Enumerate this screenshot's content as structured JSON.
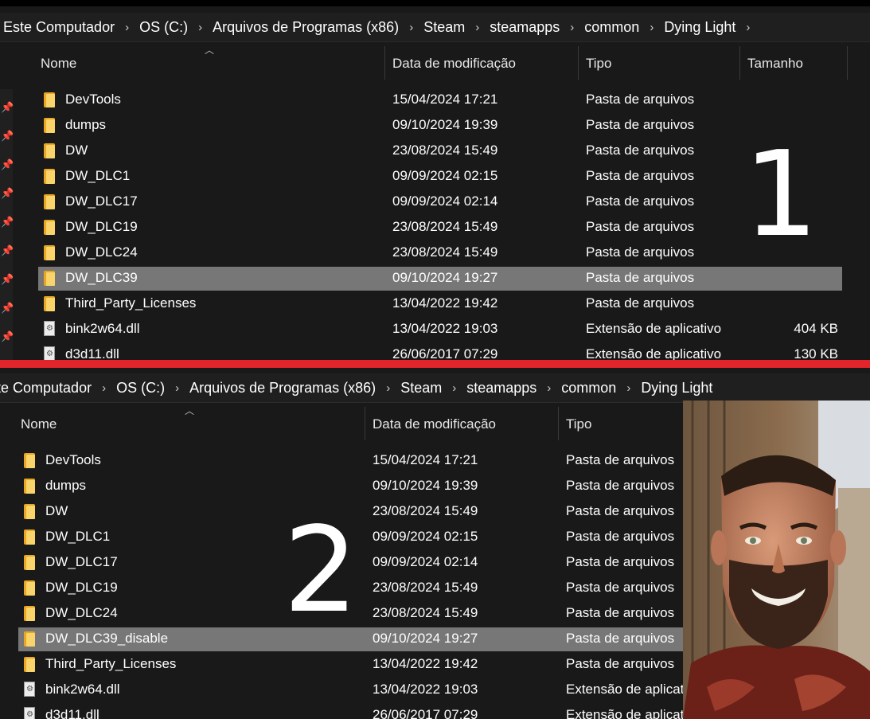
{
  "breadcrumb": [
    "Este Computador",
    "OS (C:)",
    "Arquivos de Programas (x86)",
    "Steam",
    "steamapps",
    "common",
    "Dying Light"
  ],
  "columns": {
    "name": "Nome",
    "date": "Data de modificação",
    "type": "Tipo",
    "size": "Tamanho"
  },
  "panel1": {
    "label": "1",
    "rows": [
      {
        "name": "DevTools",
        "date": "15/04/2024 17:21",
        "type": "Pasta de arquivos",
        "size": ""
      },
      {
        "name": "dumps",
        "date": "09/10/2024 19:39",
        "type": "Pasta de arquivos",
        "size": ""
      },
      {
        "name": "DW",
        "date": "23/08/2024 15:49",
        "type": "Pasta de arquivos",
        "size": ""
      },
      {
        "name": "DW_DLC1",
        "date": "09/09/2024 02:15",
        "type": "Pasta de arquivos",
        "size": ""
      },
      {
        "name": "DW_DLC17",
        "date": "09/09/2024 02:14",
        "type": "Pasta de arquivos",
        "size": ""
      },
      {
        "name": "DW_DLC19",
        "date": "23/08/2024 15:49",
        "type": "Pasta de arquivos",
        "size": ""
      },
      {
        "name": "DW_DLC24",
        "date": "23/08/2024 15:49",
        "type": "Pasta de arquivos",
        "size": ""
      },
      {
        "name": "DW_DLC39",
        "date": "09/10/2024 19:27",
        "type": "Pasta de arquivos",
        "size": ""
      },
      {
        "name": "Third_Party_Licenses",
        "date": "13/04/2022 19:42",
        "type": "Pasta de arquivos",
        "size": ""
      },
      {
        "name": "bink2w64.dll",
        "date": "13/04/2022 19:03",
        "type": "Extensão de aplicativo",
        "size": "404 KB"
      },
      {
        "name": "d3d11.dll",
        "date": "26/06/2017 07:29",
        "type": "Extensão de aplicativo",
        "size": "130 KB"
      }
    ]
  },
  "panel2": {
    "label": "2",
    "rows": [
      {
        "name": "DevTools",
        "date": "15/04/2024 17:21",
        "type": "Pasta de arquivos"
      },
      {
        "name": "dumps",
        "date": "09/10/2024 19:39",
        "type": "Pasta de arquivos"
      },
      {
        "name": "DW",
        "date": "23/08/2024 15:49",
        "type": "Pasta de arquivos"
      },
      {
        "name": "DW_DLC1",
        "date": "09/09/2024 02:15",
        "type": "Pasta de arquivos"
      },
      {
        "name": "DW_DLC17",
        "date": "09/09/2024 02:14",
        "type": "Pasta de arquivos"
      },
      {
        "name": "DW_DLC19",
        "date": "23/08/2024 15:49",
        "type": "Pasta de arquivos"
      },
      {
        "name": "DW_DLC24",
        "date": "23/08/2024 15:49",
        "type": "Pasta de arquivos"
      },
      {
        "name": "DW_DLC39_disable",
        "date": "09/10/2024 19:27",
        "type": "Pasta de arquivos"
      },
      {
        "name": "Third_Party_Licenses",
        "date": "13/04/2022 19:42",
        "type": "Pasta de arquivos"
      },
      {
        "name": "bink2w64.dll",
        "date": "13/04/2022 19:03",
        "type": "Extensão de aplicativo"
      },
      {
        "name": "d3d11.dll",
        "date": "26/06/2017 07:29",
        "type": "Extensão de aplicativo"
      }
    ]
  },
  "colors": {
    "background": "#191919",
    "selection": "#777777",
    "separator": "#e3242b",
    "folder": "#f8d46a"
  }
}
